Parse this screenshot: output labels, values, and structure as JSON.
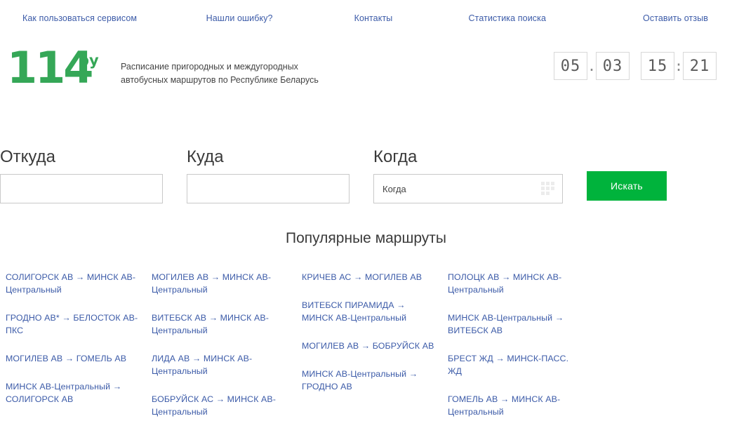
{
  "topnav": {
    "items": [
      {
        "label": "Как пользоваться сервисом"
      },
      {
        "label": "Нашли ошибку?"
      },
      {
        "label": "Контакты"
      },
      {
        "label": "Статистика поиска"
      },
      {
        "label": "Оставить отзыв"
      }
    ]
  },
  "brand": {
    "logo_number": "114",
    "logo_suffix": "by",
    "tagline_line1": "Расписание пригородных и междугородных",
    "tagline_line2": "автобусных маршрутов по Республике Беларусь",
    "logo_color": "#35a757"
  },
  "clock": {
    "date_day": "05",
    "date_month": "03",
    "date_separator": ".",
    "time_hours": "15",
    "time_minutes": "21",
    "time_separator": ":"
  },
  "search": {
    "from_label": "Откуда",
    "from_value": "",
    "from_placeholder": "",
    "to_label": "Куда",
    "to_value": "",
    "to_placeholder": "",
    "when_label": "Когда",
    "when_value": "",
    "when_placeholder": "Когда",
    "submit_label": "Искать",
    "submit_color": "#00b33c"
  },
  "popular": {
    "title": "Популярные маршруты",
    "link_color": "#3c5ba8",
    "columns": [
      {
        "routes": [
          {
            "from": "СОЛИГОРСК АВ",
            "to": "МИНСК АВ-Центральный"
          },
          {
            "from": "ГРОДНО АВ*",
            "to": "БЕЛОСТОК АВ-ПКС"
          },
          {
            "from": "МОГИЛЕВ АВ",
            "to": "ГОМЕЛЬ АВ"
          },
          {
            "from": "МИНСК АВ-Центральный",
            "to": "СОЛИГОРСК АВ"
          }
        ]
      },
      {
        "routes": [
          {
            "from": "МОГИЛЕВ АВ",
            "to": "МИНСК АВ-Центральный"
          },
          {
            "from": "ВИТЕБСК АВ",
            "to": "МИНСК АВ-Центральный"
          },
          {
            "from": "ЛИДА АВ",
            "to": "МИНСК АВ-Центральный"
          },
          {
            "from": "БОБРУЙСК АС",
            "to": "МИНСК АВ-Центральный"
          }
        ]
      },
      {
        "routes": [
          {
            "from": "КРИЧЕВ АС",
            "to": "МОГИЛЕВ АВ"
          },
          {
            "from": "ВИТЕБСК ПИРАМИДА",
            "to": "МИНСК АВ-Центральный"
          },
          {
            "from": "МОГИЛЕВ АВ",
            "to": "БОБРУЙСК АВ"
          },
          {
            "from": "МИНСК АВ-Центральный",
            "to": "ГРОДНО АВ"
          }
        ]
      },
      {
        "routes": [
          {
            "from": "ПОЛОЦК АВ",
            "to": "МИНСК АВ-Центральный"
          },
          {
            "from": "МИНСК АВ-Центральный",
            "to": "ВИТЕБСК АВ"
          },
          {
            "from": "БРЕСТ ЖД",
            "to": "МИНСК-ПАСС. ЖД"
          },
          {
            "from": "ГОМЕЛЬ АВ",
            "to": "МИНСК АВ-Центральный"
          }
        ]
      }
    ]
  },
  "icons": {
    "calendar": "calendar-grid-icon"
  }
}
